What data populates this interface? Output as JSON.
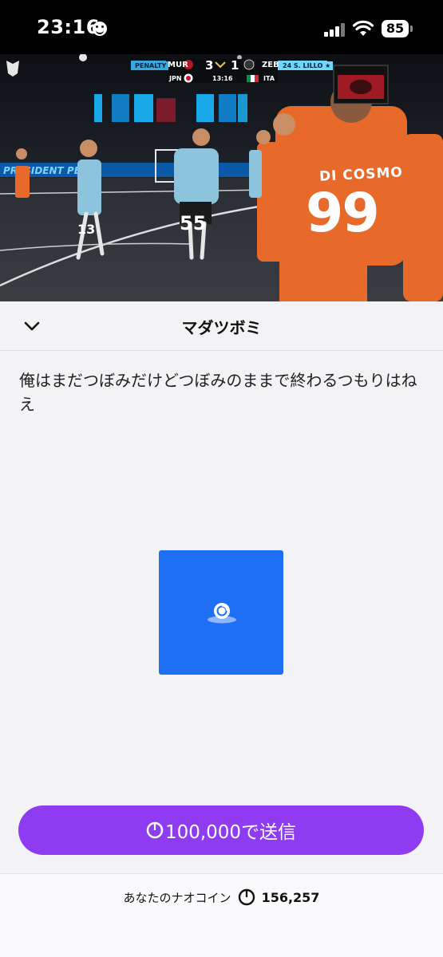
{
  "status_bar": {
    "time": "23:16",
    "battery": "85"
  },
  "video": {
    "scoreboard": {
      "label": "PENALTY",
      "home_team": "MUR",
      "home_country": "JPN",
      "home_score": "3",
      "away_score": "1",
      "away_team": "ZEB",
      "away_country": "ITA",
      "clock": "13:16",
      "player_tag": "24 S. LILLO ★"
    },
    "jersey_name": "DI COSMO",
    "jersey_number": "99",
    "jersey_number_2": "55",
    "jersey_number_3": "13"
  },
  "header": {
    "title": "マダツボミ"
  },
  "lyric": "俺はまだつぼみだけどつぼみのままで終わるつもりはねえ",
  "item": {
    "icon": "coin-drop-icon",
    "color": "#1f6ff5"
  },
  "send_button": {
    "label": "100,000で送信",
    "color": "#8f3bf2"
  },
  "footer": {
    "label": "あなたのナオコイン",
    "amount": "156,257"
  }
}
